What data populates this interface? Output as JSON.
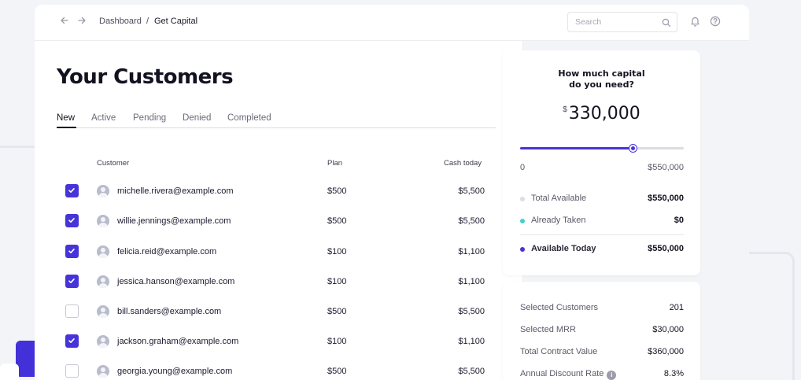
{
  "breadcrumb": {
    "root": "Dashboard",
    "separator": "/",
    "current": "Get Capital"
  },
  "search": {
    "placeholder": "Search"
  },
  "page_title": "Your Customers",
  "tabs": [
    {
      "label": "New",
      "active": true
    },
    {
      "label": "Active"
    },
    {
      "label": "Pending"
    },
    {
      "label": "Denied"
    },
    {
      "label": "Completed"
    }
  ],
  "table": {
    "columns": {
      "customer": "Customer",
      "plan": "Plan",
      "cash": "Cash today"
    },
    "rows": [
      {
        "email": "michelle.rivera@example.com",
        "plan": "$500",
        "cash": "$5,500",
        "checked": true
      },
      {
        "email": "willie.jennings@example.com",
        "plan": "$500",
        "cash": "$5,500",
        "checked": true
      },
      {
        "email": "felicia.reid@example.com",
        "plan": "$100",
        "cash": "$1,100",
        "checked": true
      },
      {
        "email": "jessica.hanson@example.com",
        "plan": "$100",
        "cash": "$1,100",
        "checked": true
      },
      {
        "email": "bill.sanders@example.com",
        "plan": "$500",
        "cash": "$5,500",
        "checked": false
      },
      {
        "email": "jackson.graham@example.com",
        "plan": "$100",
        "cash": "$1,100",
        "checked": true
      },
      {
        "email": "georgia.young@example.com",
        "plan": "$500",
        "cash": "$5,500",
        "checked": false
      }
    ]
  },
  "capital": {
    "question_line1": "How much capital",
    "question_line2": "do you need?",
    "currency": "$",
    "amount": "330,000",
    "slider": {
      "min_label": "0",
      "max_label": "$550,000",
      "value_fraction": 0.69
    },
    "summary": [
      {
        "label": "Total Available",
        "value": "$550,000",
        "dot_color": "#dcdce6"
      },
      {
        "label": "Already Taken",
        "value": "$0",
        "dot_color": "#3fd3c7"
      },
      {
        "label": "Available Today",
        "value": "$550,000",
        "dot_color": "#4734d9"
      }
    ]
  },
  "stats": [
    {
      "label": "Selected Customers",
      "value": "201"
    },
    {
      "label": "Selected MRR",
      "value": "$30,000"
    },
    {
      "label": "Total Contract Value",
      "value": "$360,000"
    },
    {
      "label": "Annual Discount Rate",
      "value": "8.3%",
      "info": "i"
    }
  ],
  "colors": {
    "accent": "#4734d9",
    "teal": "#3fd3c7"
  },
  "icons": [
    "back-arrow-icon",
    "forward-arrow-icon",
    "search-icon",
    "bell-icon",
    "help-icon",
    "checkmark-icon",
    "user-avatar-icon",
    "info-icon"
  ]
}
